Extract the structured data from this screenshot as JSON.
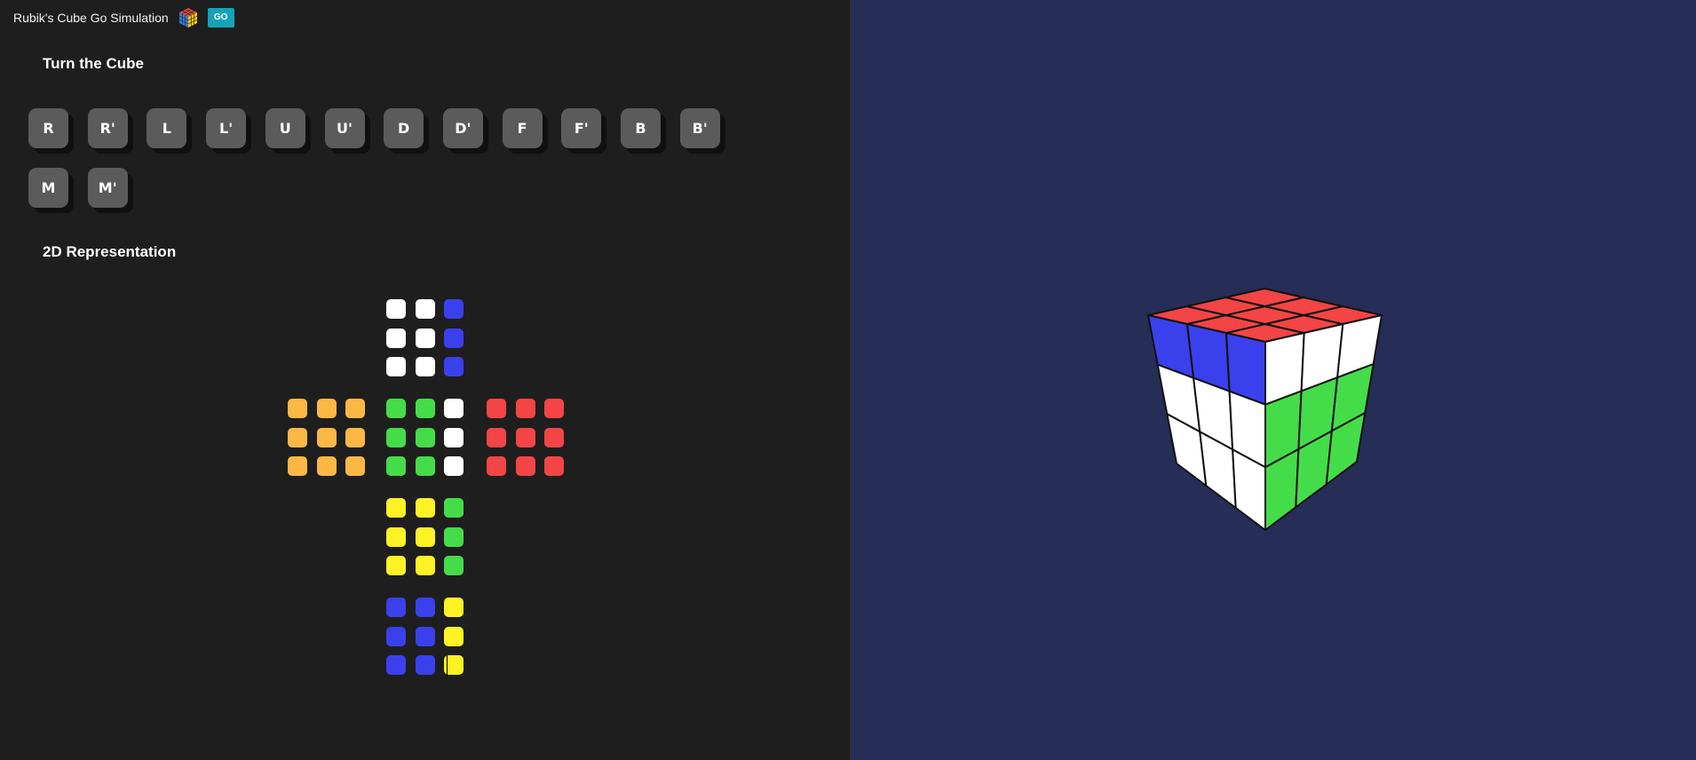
{
  "colors": {
    "W": "#ffffff",
    "B": "#3a40ec",
    "O": "#fbb844",
    "G": "#45dc4a",
    "R": "#f34545",
    "Y": "#fff225",
    "left_bg": "#1e1e1e",
    "right_bg": "#262d56",
    "button_bg": "#5b5b5b",
    "badge_bg": "#17a2b8"
  },
  "header": {
    "title": "Rubik's Cube Go Simulation",
    "logo_icon": "rubiks-cube-icon",
    "badge_text": "GO"
  },
  "turn_section": {
    "title": "Turn the Cube",
    "moves": [
      "R",
      "R'",
      "L",
      "L'",
      "U",
      "U'",
      "D",
      "D'",
      "F",
      "F'",
      "B",
      "B'",
      "M",
      "M'"
    ]
  },
  "net_section": {
    "title": "2D Representation",
    "faces": [
      {
        "id": "top",
        "grid": [
          [
            "W",
            "W",
            "B"
          ],
          [
            "W",
            "W",
            "B"
          ],
          [
            "W",
            "W",
            "B"
          ]
        ]
      },
      {
        "id": "left",
        "grid": [
          [
            "O",
            "O",
            "O"
          ],
          [
            "O",
            "O",
            "O"
          ],
          [
            "O",
            "O",
            "O"
          ]
        ]
      },
      {
        "id": "front",
        "grid": [
          [
            "G",
            "G",
            "W"
          ],
          [
            "G",
            "G",
            "W"
          ],
          [
            "G",
            "G",
            "W"
          ]
        ]
      },
      {
        "id": "right",
        "grid": [
          [
            "R",
            "R",
            "R"
          ],
          [
            "R",
            "R",
            "R"
          ],
          [
            "R",
            "R",
            "R"
          ]
        ]
      },
      {
        "id": "bottom",
        "grid": [
          [
            "Y",
            "Y",
            "G"
          ],
          [
            "Y",
            "Y",
            "G"
          ],
          [
            "Y",
            "Y",
            "G"
          ]
        ]
      },
      {
        "id": "back",
        "grid": [
          [
            "B",
            "B",
            "Y"
          ],
          [
            "B",
            "B",
            "Y"
          ],
          [
            "B",
            "B",
            "Y"
          ]
        ]
      }
    ]
  },
  "cube3d": {
    "top": [
      [
        "R",
        "R",
        "R"
      ],
      [
        "R",
        "R",
        "R"
      ],
      [
        "R",
        "R",
        "R"
      ]
    ],
    "left": [
      [
        "B",
        "B",
        "B"
      ],
      [
        "W",
        "W",
        "W"
      ],
      [
        "W",
        "W",
        "W"
      ]
    ],
    "right": [
      [
        "W",
        "W",
        "W"
      ],
      [
        "G",
        "G",
        "G"
      ],
      [
        "G",
        "G",
        "G"
      ]
    ]
  }
}
